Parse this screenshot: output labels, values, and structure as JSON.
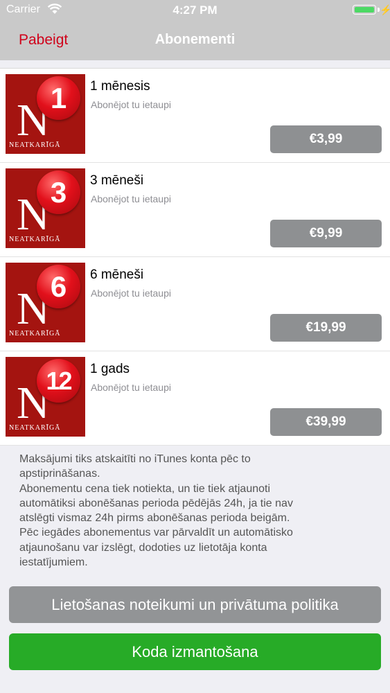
{
  "status_bar": {
    "carrier": "Carrier",
    "time": "4:27 PM",
    "battery_percent": 100
  },
  "nav": {
    "back_label": "Pabeigt",
    "title": "Abonementi"
  },
  "colors": {
    "bar_bg": "#c9c9c9",
    "back_link": "#d0021b",
    "logo_bg": "#a41410",
    "price_button": "#8e9092",
    "terms_button": "#929496",
    "code_button": "#27ab27"
  },
  "logo": {
    "letter": "N",
    "wordmark": "NEATKARĪGĀ"
  },
  "subscriptions": [
    {
      "badge": "1",
      "title": "1 mēnesis",
      "subtitle": "Abonējot tu ietaupi",
      "price": "€3,99"
    },
    {
      "badge": "3",
      "title": "3 mēneši",
      "subtitle": "Abonējot tu ietaupi",
      "price": "€9,99"
    },
    {
      "badge": "6",
      "title": "6 mēneši",
      "subtitle": "Abonējot tu ietaupi",
      "price": "€19,99"
    },
    {
      "badge": "12",
      "title": "1 gads",
      "subtitle": "Abonējot tu ietaupi",
      "price": "€39,99"
    }
  ],
  "info_lines": [
    "Maksājumi tiks atskaitīti no iTunes konta pēc to",
    "apstiprināšanas.",
    "Abonementu cena tiek notiekta, un tie tiek atjaunoti",
    "automātiksi abonēšanas perioda pēdējās 24h, ja tie nav",
    "atslēgti vismaz 24h pirms abonēšanas perioda beigām.",
    "Pēc iegādes abonementus var pārvaldīt un automātisko",
    "atjaunošanu var izslēgt, dodoties uz lietotāja konta",
    "iestatījumiem."
  ],
  "buttons": {
    "terms": "Lietošanas noteikumi un privātuma politika",
    "code": "Koda izmantošana"
  }
}
